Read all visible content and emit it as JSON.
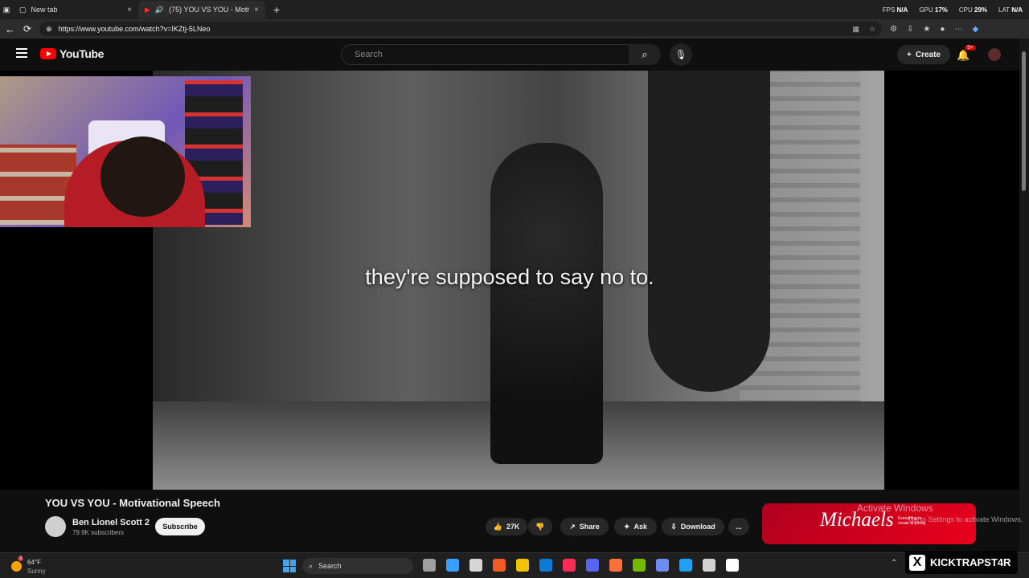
{
  "browser": {
    "tabs": [
      {
        "label": "New tab",
        "close": "×"
      },
      {
        "label": "(75) YOU VS YOU - Motivatio",
        "close": "×"
      }
    ],
    "new_tab": "+",
    "stats": {
      "fps_label": "FPS",
      "fps": "N/A",
      "gpu_label": "GPU",
      "gpu": "17%",
      "cpu_label": "CPU",
      "cpu": "29%",
      "lat_label": "LAT",
      "lat": "N/A"
    },
    "url": "https://www.youtube.com/watch?v=IKZtj-5LNeo",
    "icons": [
      "tab-grid-icon",
      "star-icon",
      "extensions-icon",
      "downloads-icon",
      "profile-icon",
      "menu-icon",
      "copilot-icon"
    ]
  },
  "youtube": {
    "logo": "YouTube",
    "search_placeholder": "Search",
    "create_label": "Create",
    "notifications_badge": "9+"
  },
  "video": {
    "caption": "they're supposed to say no to.",
    "title": "YOU VS YOU - Motivational Speech",
    "channel": "Ben Lionel Scott 2",
    "subscribers": "79.9K subscribers",
    "subscribe_label": "Subscribe",
    "likes": "27K",
    "share_label": "Share",
    "ask_label": "Ask",
    "download_label": "Download",
    "more_label": "..."
  },
  "ad": {
    "brand": "Michaels",
    "slogan": "Everything to create anything",
    "activate_title": "Activate Windows",
    "activate_sub": "Go to Settings to activate Windows."
  },
  "taskbar": {
    "weather_badge": "3",
    "temperature": "64°F",
    "condition": "Sunny",
    "search_label": "Search",
    "app_colors": [
      "#9f9f9f",
      "#39a0ff",
      "#d5d5d5",
      "#f05a24",
      "#f3c200",
      "#0a7bd6",
      "#ff2d55",
      "#5865f2",
      "#ff7139",
      "#76b900",
      "#6d8df2",
      "#1ea1f2",
      "#d2d2d2",
      "#ffffff"
    ],
    "kick_text": "KICKTRAPST4R"
  }
}
